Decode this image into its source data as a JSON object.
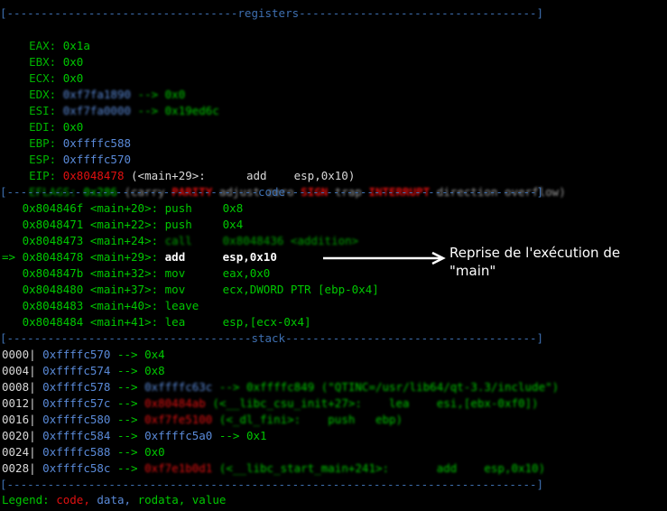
{
  "separators": {
    "registers": "[----------------------------------registers-----------------------------------]",
    "code": "[-------------------------------------code-------------------------------------]",
    "stack": "[------------------------------------stack-------------------------------------]",
    "bottom": "[------------------------------------------------------------------------------]"
  },
  "registers": [
    {
      "name": "EAX:",
      "value": "0x1a",
      "extra": ""
    },
    {
      "name": "EBX:",
      "value": "0x0",
      "extra": ""
    },
    {
      "name": "ECX:",
      "value": "0x0",
      "extra": ""
    },
    {
      "name": "EDX:",
      "value": "0xf7fa1890",
      "extra": "--> 0x0"
    },
    {
      "name": "ESI:",
      "value": "0xf7fa0000",
      "extra": "--> 0x19ed6c"
    },
    {
      "name": "EDI:",
      "value": "0x0",
      "extra": ""
    },
    {
      "name": "EBP:",
      "value": "0xffffc588",
      "extra": ""
    },
    {
      "name": "ESP:",
      "value": "0xffffc570",
      "extra": ""
    },
    {
      "name": "EIP:",
      "value": "0x8048478",
      "extra": "(<main+29>:      add    esp,0x10)"
    }
  ],
  "eflags": {
    "label": "EFLAGS:",
    "value": "0x286",
    "open": "(carry",
    "parity": "PARITY",
    "mid1": "adjust zero",
    "sign": "SIGN",
    "trap": "trap",
    "interrupt": "INTERRUPT",
    "tail": "direction overflow)"
  },
  "code": [
    {
      "marker": "  ",
      "addr": "0x804846f",
      "sym": "<main+20>:",
      "op": "push",
      "args": "0x8"
    },
    {
      "marker": "  ",
      "addr": "0x8048471",
      "sym": "<main+22>:",
      "op": "push",
      "args": "0x4"
    },
    {
      "marker": "  ",
      "addr": "0x8048473",
      "sym": "<main+24>:",
      "op": "call",
      "args": "0x8048436 <addition>"
    },
    {
      "marker": "=>",
      "addr": "0x8048478",
      "sym": "<main+29>:",
      "op": "add",
      "args": "esp,0x10"
    },
    {
      "marker": "  ",
      "addr": "0x804847b",
      "sym": "<main+32>:",
      "op": "mov",
      "args": "eax,0x0"
    },
    {
      "marker": "  ",
      "addr": "0x8048480",
      "sym": "<main+37>:",
      "op": "mov",
      "args": "ecx,DWORD PTR [ebp-0x4]"
    },
    {
      "marker": "  ",
      "addr": "0x8048483",
      "sym": "<main+40>:",
      "op": "leave",
      "args": ""
    },
    {
      "marker": "  ",
      "addr": "0x8048484",
      "sym": "<main+41>:",
      "op": "lea",
      "args": "esp,[ecx-0x4]"
    }
  ],
  "stack": [
    {
      "off": "0000|",
      "addr": "0xffffc570",
      "arrow": "-->",
      "val": "0x4",
      "rest": ""
    },
    {
      "off": "0004|",
      "addr": "0xffffc574",
      "arrow": "-->",
      "val": "0x8",
      "rest": ""
    },
    {
      "off": "0008|",
      "addr": "0xffffc578",
      "arrow": "-->",
      "val": "0xffffc63c",
      "rest": "--> 0xffffc849 (\"QTINC=/usr/lib64/qt-3.3/include\")"
    },
    {
      "off": "0012|",
      "addr": "0xffffc57c",
      "arrow": "-->",
      "val": "0x80484ab",
      "rest": "(<__libc_csu_init+27>:    lea    esi,[ebx-0xf0])"
    },
    {
      "off": "0016|",
      "addr": "0xffffc580",
      "arrow": "-->",
      "val": "0xf7fe5100",
      "rest": "(<_dl_fini>:    push   ebp)"
    },
    {
      "off": "0020|",
      "addr": "0xffffc584",
      "arrow": "-->",
      "val": "0xffffc5a0",
      "rest": "--> 0x1"
    },
    {
      "off": "0024|",
      "addr": "0xffffc588",
      "arrow": "-->",
      "val": "0x0",
      "rest": ""
    },
    {
      "off": "0028|",
      "addr": "0xffffc58c",
      "arrow": "-->",
      "val": "0xf7e1b0d1",
      "rest": "(<__libc_start_main+241>:       add    esp,0x10)"
    }
  ],
  "legend": {
    "label": "Legend:",
    "code": "code,",
    "data": "data,",
    "rodata": "rodata,",
    "value": "value"
  },
  "annotation": {
    "line1": "Reprise de l'exécution de",
    "line2": "\"main\""
  }
}
